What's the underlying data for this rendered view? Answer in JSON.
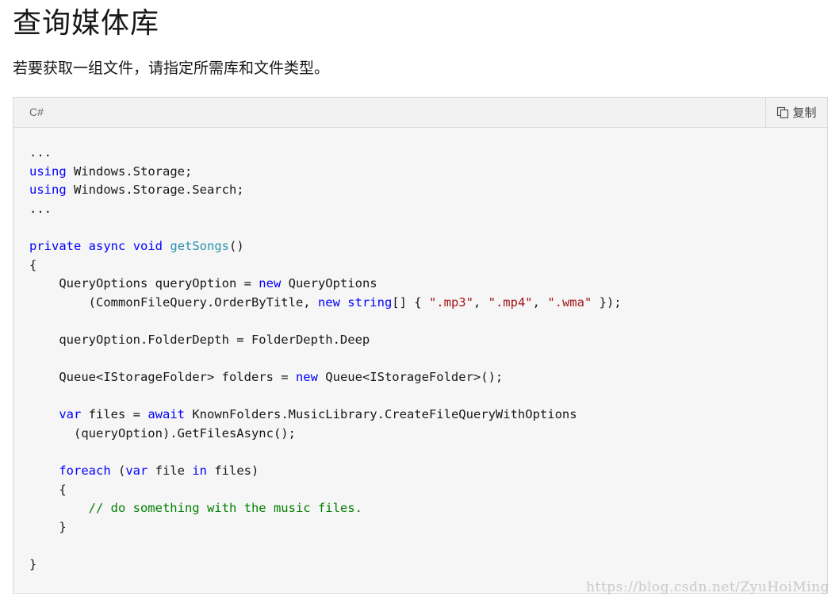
{
  "page": {
    "title": "查询媒体库",
    "intro": "若要获取一组文件，请指定所需库和文件类型。"
  },
  "code_block": {
    "language": "C#",
    "copy_label": "复制",
    "lines": [
      [
        {
          "t": "..."
        }
      ],
      [
        {
          "t": "using",
          "c": "kw"
        },
        {
          "t": " Windows.Storage;"
        }
      ],
      [
        {
          "t": "using",
          "c": "kw"
        },
        {
          "t": " Windows.Storage.Search;"
        }
      ],
      [
        {
          "t": "..."
        }
      ],
      [],
      [
        {
          "t": "private",
          "c": "kw"
        },
        {
          "t": " "
        },
        {
          "t": "async",
          "c": "kw"
        },
        {
          "t": " "
        },
        {
          "t": "void",
          "c": "kw"
        },
        {
          "t": " "
        },
        {
          "t": "getSongs",
          "c": "fn"
        },
        {
          "t": "()"
        }
      ],
      [
        {
          "t": "{"
        }
      ],
      [
        {
          "t": "    QueryOptions queryOption = "
        },
        {
          "t": "new",
          "c": "kw"
        },
        {
          "t": " QueryOptions"
        }
      ],
      [
        {
          "t": "        (CommonFileQuery.OrderByTitle, "
        },
        {
          "t": "new",
          "c": "kw"
        },
        {
          "t": " "
        },
        {
          "t": "string",
          "c": "kw"
        },
        {
          "t": "[] { "
        },
        {
          "t": "\".mp3\"",
          "c": "str"
        },
        {
          "t": ", "
        },
        {
          "t": "\".mp4\"",
          "c": "str"
        },
        {
          "t": ", "
        },
        {
          "t": "\".wma\"",
          "c": "str"
        },
        {
          "t": " });"
        }
      ],
      [],
      [
        {
          "t": "    queryOption.FolderDepth = FolderDepth.Deep"
        }
      ],
      [],
      [
        {
          "t": "    Queue<IStorageFolder> folders = "
        },
        {
          "t": "new",
          "c": "kw"
        },
        {
          "t": " Queue<IStorageFolder>();"
        }
      ],
      [],
      [
        {
          "t": "    "
        },
        {
          "t": "var",
          "c": "kw"
        },
        {
          "t": " files = "
        },
        {
          "t": "await",
          "c": "kw"
        },
        {
          "t": " KnownFolders.MusicLibrary.CreateFileQueryWithOptions"
        }
      ],
      [
        {
          "t": "      (queryOption).GetFilesAsync();"
        }
      ],
      [],
      [
        {
          "t": "    "
        },
        {
          "t": "foreach",
          "c": "kw"
        },
        {
          "t": " ("
        },
        {
          "t": "var",
          "c": "kw"
        },
        {
          "t": " file "
        },
        {
          "t": "in",
          "c": "kw"
        },
        {
          "t": " files)"
        }
      ],
      [
        {
          "t": "    {"
        }
      ],
      [
        {
          "t": "        "
        },
        {
          "t": "// do something with the music files.",
          "c": "cm"
        }
      ],
      [
        {
          "t": "    }"
        }
      ],
      [],
      [
        {
          "t": "}"
        }
      ]
    ]
  },
  "watermark": "https://blog.csdn.net/ZyuHoiMing",
  "colors": {
    "keyword": "#0101fd",
    "type_name": "#2b91af",
    "string": "#a31515",
    "comment": "#008000"
  },
  "icons": {
    "copy": "copy-icon"
  }
}
